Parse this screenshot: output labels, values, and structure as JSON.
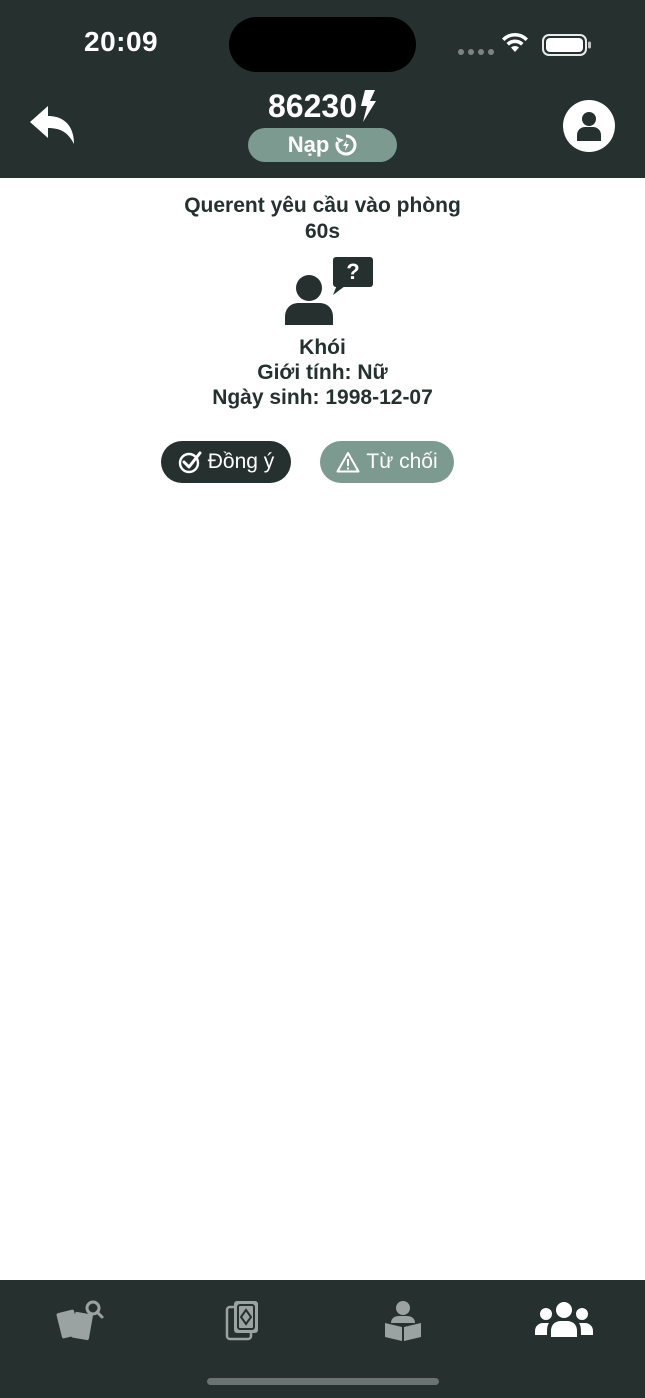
{
  "status_bar": {
    "time": "20:09"
  },
  "header": {
    "balance": "86230",
    "topup_label": "Nạp"
  },
  "request": {
    "title": "Querent yêu cầu vào phòng",
    "countdown": "60s",
    "name": "Khói",
    "gender": "Giới tính: Nữ",
    "birthday": "Ngày sinh: 1998-12-07"
  },
  "actions": {
    "accept_label": "Đồng ý",
    "reject_label": "Từ chối"
  },
  "tabbar": {
    "items": [
      {
        "icon": "tarot-search-icon",
        "active": false
      },
      {
        "icon": "card-deck-icon",
        "active": false
      },
      {
        "icon": "reader-book-icon",
        "active": false
      },
      {
        "icon": "group-icon",
        "active": true
      }
    ]
  },
  "colors": {
    "dark": "#26302f",
    "accent": "#7d9a90",
    "inactive_icon": "#9aa3a1"
  }
}
